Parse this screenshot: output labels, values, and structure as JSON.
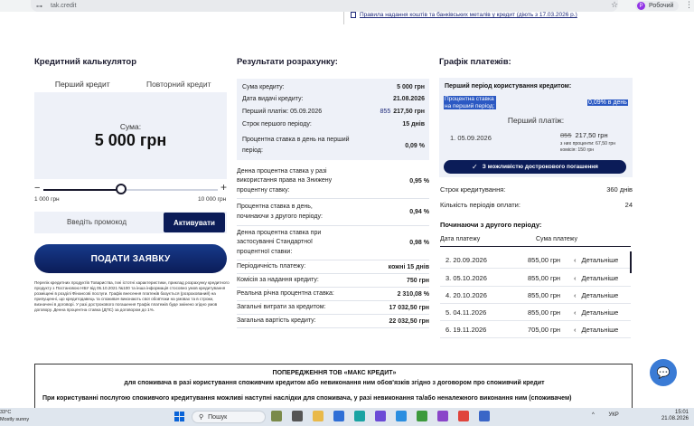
{
  "browser": {
    "url": "tak.credit",
    "profile_initial": "Р",
    "profile_label": "Робочий"
  },
  "top_link": "Правила надання коштів та банківських металів у кредит (діють з 17.03.2026 р.)",
  "calculator": {
    "title": "Кредитний калькулятор",
    "tabs": [
      "Перший кредит",
      "Повторний кредит"
    ],
    "amount_label": "Сума:",
    "amount_value": "5 000 грн",
    "slider_min": "1 000 грн",
    "slider_max": "10 000 грн",
    "slider_fraction": 0.444,
    "slider_minus": "−",
    "slider_plus": "+",
    "promo_placeholder": "Введіть промокод",
    "promo_button": "Активувати",
    "apply_button": "ПОДАТИ ЗАЯВКУ",
    "disclaimer": "Перелік кредитних продуктів Товариства, їхні істотні характеристики, приклад розрахунку кредитного продукту з Постановою НБУ від 05.10.2021 №100 та інша інформація стосовно умов кредитування розміщені в розділі Фінансові послуги. Графік внесення платежів базується (розрахований) на припущенні, що кредитодавець та споживач виконають свої обов'язки на умовах та в строки, визначені в договорі. У разі дострокового погашення Графік платежів буде змінено згідно умов договору. Денна процентна ставка (ДПС) за договором до 1%."
  },
  "results": {
    "title": "Результати розрахунку:",
    "box_rows": [
      {
        "k": "Сума кредиту:",
        "v": "5 000 грн"
      },
      {
        "k": "Дата видачі кредиту:",
        "v": "21.08.2026"
      },
      {
        "k": "Перший платіж: 05.09.2026",
        "strike": "855",
        "v": "217,50 грн"
      },
      {
        "k": "Строк першого періоду:",
        "v": "15 днів"
      },
      {
        "k": "Процентна ставка в день на перший період:",
        "v": "0,09 %"
      }
    ],
    "rows": [
      {
        "k": "Денна процентна ставка у разі використання права на Знижену процентну ставку:",
        "v": "0,95 %"
      },
      {
        "k": "Процентна ставка в день, починаючи з другого періоду:",
        "v": "0,94 %"
      },
      {
        "k": "Денна процентна ставка при застосуванні Стандартної процентної ставки:",
        "v": "0,98 %"
      },
      {
        "k": "Періодичність платежу:",
        "v": "кожні 15 днів"
      },
      {
        "k": "Комісія за надання кредиту:",
        "v": "750 грн"
      },
      {
        "k": "Реальна річна процентна ставка:",
        "v": "2 310,08 %"
      },
      {
        "k": "Загальні витрати за кредитом:",
        "v": "17 032,50 грн"
      },
      {
        "k": "Загальна вартість кредиту:",
        "v": "22 032,50 грн"
      }
    ]
  },
  "schedule": {
    "title": "Графік платежів:",
    "box_heading": "Перший період користування кредитом:",
    "rate_label": "Процентна ставка на перший період:",
    "rate_value": "0,09% в день",
    "first_payment_label": "Перший платіж:",
    "first_date": "1. 05.09.2026",
    "first_strike": "855",
    "first_amount": "217,50 грн",
    "first_sub1": "з них проценти: 67,50 грн",
    "first_sub2": "комісія: 150 грн",
    "early_button": "З можливістю дострокового погашення",
    "term_label": "Строк кредитування:",
    "term_value": "360 днів",
    "periods_label": "Кількість періодів оплати:",
    "periods_value": "24",
    "second_heading": "Починаючи з другого періоду:",
    "col_date": "Дата платежу",
    "col_sum": "Сума платежу",
    "details_label": "Детальніше",
    "rows": [
      {
        "d": "2. 20.09.2026",
        "a": "855,00 грн"
      },
      {
        "d": "3. 05.10.2026",
        "a": "855,00 грн"
      },
      {
        "d": "4. 20.10.2026",
        "a": "855,00 грн"
      },
      {
        "d": "5. 04.11.2026",
        "a": "855,00 грн"
      },
      {
        "d": "6. 19.11.2026",
        "a": "705,00 грн"
      }
    ]
  },
  "warning": {
    "line1": "ПОПЕРЕДЖЕННЯ ТОВ «МАКС КРЕДИТ»",
    "line2": "для споживача в разі користування споживчим кредитом або невиконання ним обов'язків згідно з договором про споживчий кредит",
    "line3": "При користуванні послугою споживчого кредитування можливі наступні наслідки для споживача, у разі невиконання та/або неналежного виконання ним (споживачем)"
  },
  "taskbar": {
    "temp": "33°C",
    "weather": "Mostly sunny",
    "search": "Пошук",
    "lang": "УКР",
    "time": "15:01",
    "date": "21.08.2026"
  }
}
